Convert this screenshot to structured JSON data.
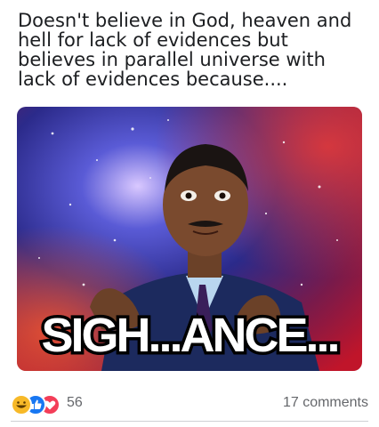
{
  "post": {
    "caption": "Doesn't believe in God, heaven and hell for lack of evidences but believes in parallel universe with lack of evidences because....",
    "meme_text": "SIGH...ANCE..."
  },
  "reactions": {
    "icons": [
      "haha-icon",
      "like-icon",
      "love-icon"
    ],
    "count": "56",
    "comments_label": "17 comments",
    "colors": {
      "haha": "#f7b928",
      "like": "#1877f2",
      "love": "#f33e58"
    }
  }
}
